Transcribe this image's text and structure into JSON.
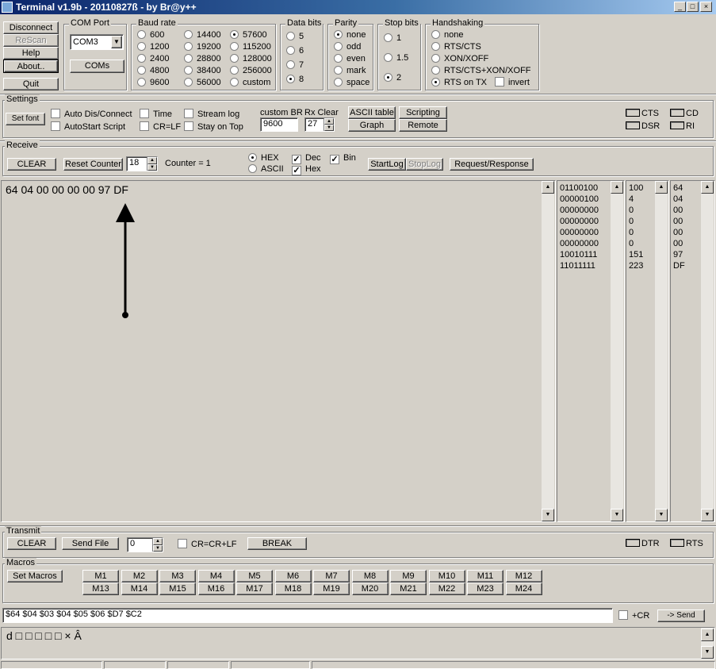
{
  "window": {
    "title": "Terminal v1.9b - 20110827ß - by Br@y++"
  },
  "left_buttons": {
    "disconnect": "Disconnect",
    "rescan": "ReScan",
    "help": "Help",
    "about": "About..",
    "quit": "Quit"
  },
  "com_port": {
    "label": "COM Port",
    "value": "COM3",
    "coms_button": "COMs"
  },
  "baud_rate": {
    "label": "Baud rate",
    "options": [
      "600",
      "1200",
      "2400",
      "4800",
      "9600",
      "14400",
      "19200",
      "28800",
      "38400",
      "56000",
      "57600",
      "115200",
      "128000",
      "256000",
      "custom"
    ],
    "selected": "57600"
  },
  "data_bits": {
    "label": "Data bits",
    "options": [
      "5",
      "6",
      "7",
      "8"
    ],
    "selected": "8"
  },
  "parity": {
    "label": "Parity",
    "options": [
      "none",
      "odd",
      "even",
      "mark",
      "space"
    ],
    "selected": "none"
  },
  "stop_bits": {
    "label": "Stop bits",
    "options": [
      "1",
      "1.5",
      "2"
    ],
    "selected": "2"
  },
  "handshaking": {
    "label": "Handshaking",
    "options": [
      "none",
      "RTS/CTS",
      "XON/XOFF",
      "RTS/CTS+XON/XOFF",
      "RTS on TX"
    ],
    "selected": "RTS on TX",
    "invert_label": "invert"
  },
  "settings": {
    "label": "Settings",
    "set_font": "Set font",
    "checks": {
      "auto_dis": "Auto Dis/Connect",
      "autostart": "AutoStart Script",
      "time": "Time",
      "crlf": "CR=LF",
      "stream_log": "Stream log",
      "stay_on_top": "Stay on Top"
    },
    "custom_br_label": "custom BR",
    "custom_br_value": "9600",
    "rx_clear_label": "Rx Clear",
    "rx_clear_value": "27",
    "ascii_table": "ASCII table",
    "scripting": "Scripting",
    "graph": "Graph",
    "remote": "Remote",
    "signals": {
      "cts": "CTS",
      "cd": "CD",
      "dsr": "DSR",
      "ri": "RI"
    }
  },
  "receive": {
    "label": "Receive",
    "clear": "CLEAR",
    "reset_counter": "Reset Counter",
    "counter_spin": "18",
    "counter_text": "Counter = 1",
    "hex": "HEX",
    "ascii": "ASCII",
    "dec": "Dec",
    "hex_chk": "Hex",
    "bin": "Bin",
    "startlog": "StartLog",
    "stoplog": "StopLog",
    "request_response": "Request/Response",
    "main_text": "64 04 00 00 00 00 97 DF",
    "bin_values": [
      "01100100",
      "00000100",
      "00000000",
      "00000000",
      "00000000",
      "00000000",
      "10010111",
      "11011111"
    ],
    "dec_values": [
      "100",
      "4",
      "0",
      "0",
      "0",
      "0",
      "151",
      "223"
    ],
    "hex_values": [
      "64",
      "04",
      "00",
      "00",
      "00",
      "00",
      "97",
      "DF"
    ]
  },
  "transmit": {
    "label": "Transmit",
    "clear": "CLEAR",
    "send_file": "Send File",
    "spin": "0",
    "cr_label": "CR=CR+LF",
    "break": "BREAK",
    "dtr": "DTR",
    "rts": "RTS"
  },
  "macros": {
    "label": "Macros",
    "set_macros": "Set Macros",
    "items": [
      "M1",
      "M2",
      "M3",
      "M4",
      "M5",
      "M6",
      "M7",
      "M8",
      "M9",
      "M10",
      "M11",
      "M12",
      "M13",
      "M14",
      "M15",
      "M16",
      "M17",
      "M18",
      "M19",
      "M20",
      "M21",
      "M22",
      "M23",
      "M24"
    ]
  },
  "send": {
    "input": "$64 $04 $03 $04 $05 $06 $D7 $C2",
    "cr_label": "+CR",
    "send_button": "-> Send"
  },
  "transmit_echo": "d □ □ □ □ □ × Â"
}
